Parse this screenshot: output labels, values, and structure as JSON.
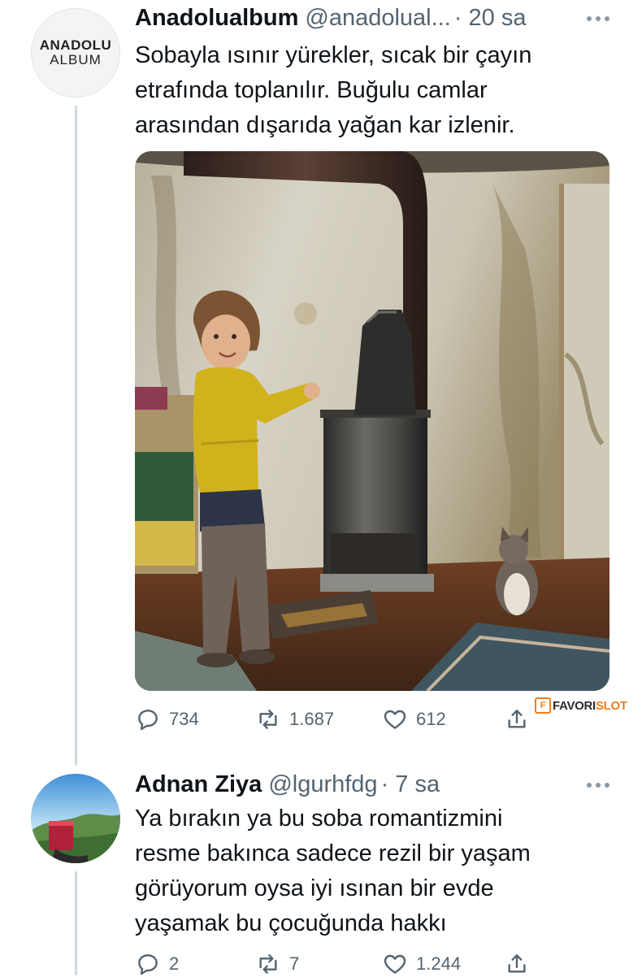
{
  "tweet1": {
    "avatar": {
      "logo_line1": "ANADOLU",
      "logo_line2": "ALBUM"
    },
    "name": "Anadolualbum",
    "handle": "@anadolual...",
    "time": "· 20 sa",
    "text_lines": [
      "Sobayla ısınır yürekler, sıcak bir çayın",
      "etrafında toplanılır. Buğulu camlar",
      "arasından dışarıda yağan kar izlenir."
    ],
    "stats": {
      "replies": "734",
      "retweets": "1.687",
      "likes": "612"
    }
  },
  "watermark": {
    "box": "F",
    "part1": "FAVORI",
    "part2": "SLOT"
  },
  "tweet2": {
    "name": "Adnan Ziya",
    "handle": "@lgurhfdg",
    "time": "· 7 sa",
    "text_lines": [
      "Ya bırakın ya bu soba romantizmini",
      "resme bakınca sadece rezil bir yaşam",
      "görüyorum oysa iyi ısınan bir evde",
      "yaşamak bu çocuğunda hakkı"
    ],
    "stats": {
      "replies": "2",
      "retweets": "7",
      "likes": "1.244"
    }
  },
  "icons": [
    "reply-icon",
    "retweet-icon",
    "like-icon",
    "share-icon",
    "more-icon"
  ],
  "colors": {
    "text": "#0f1419",
    "secondary": "#536471",
    "thread_line": "#cfd9de",
    "watermark_accent": "#f07d1d"
  }
}
